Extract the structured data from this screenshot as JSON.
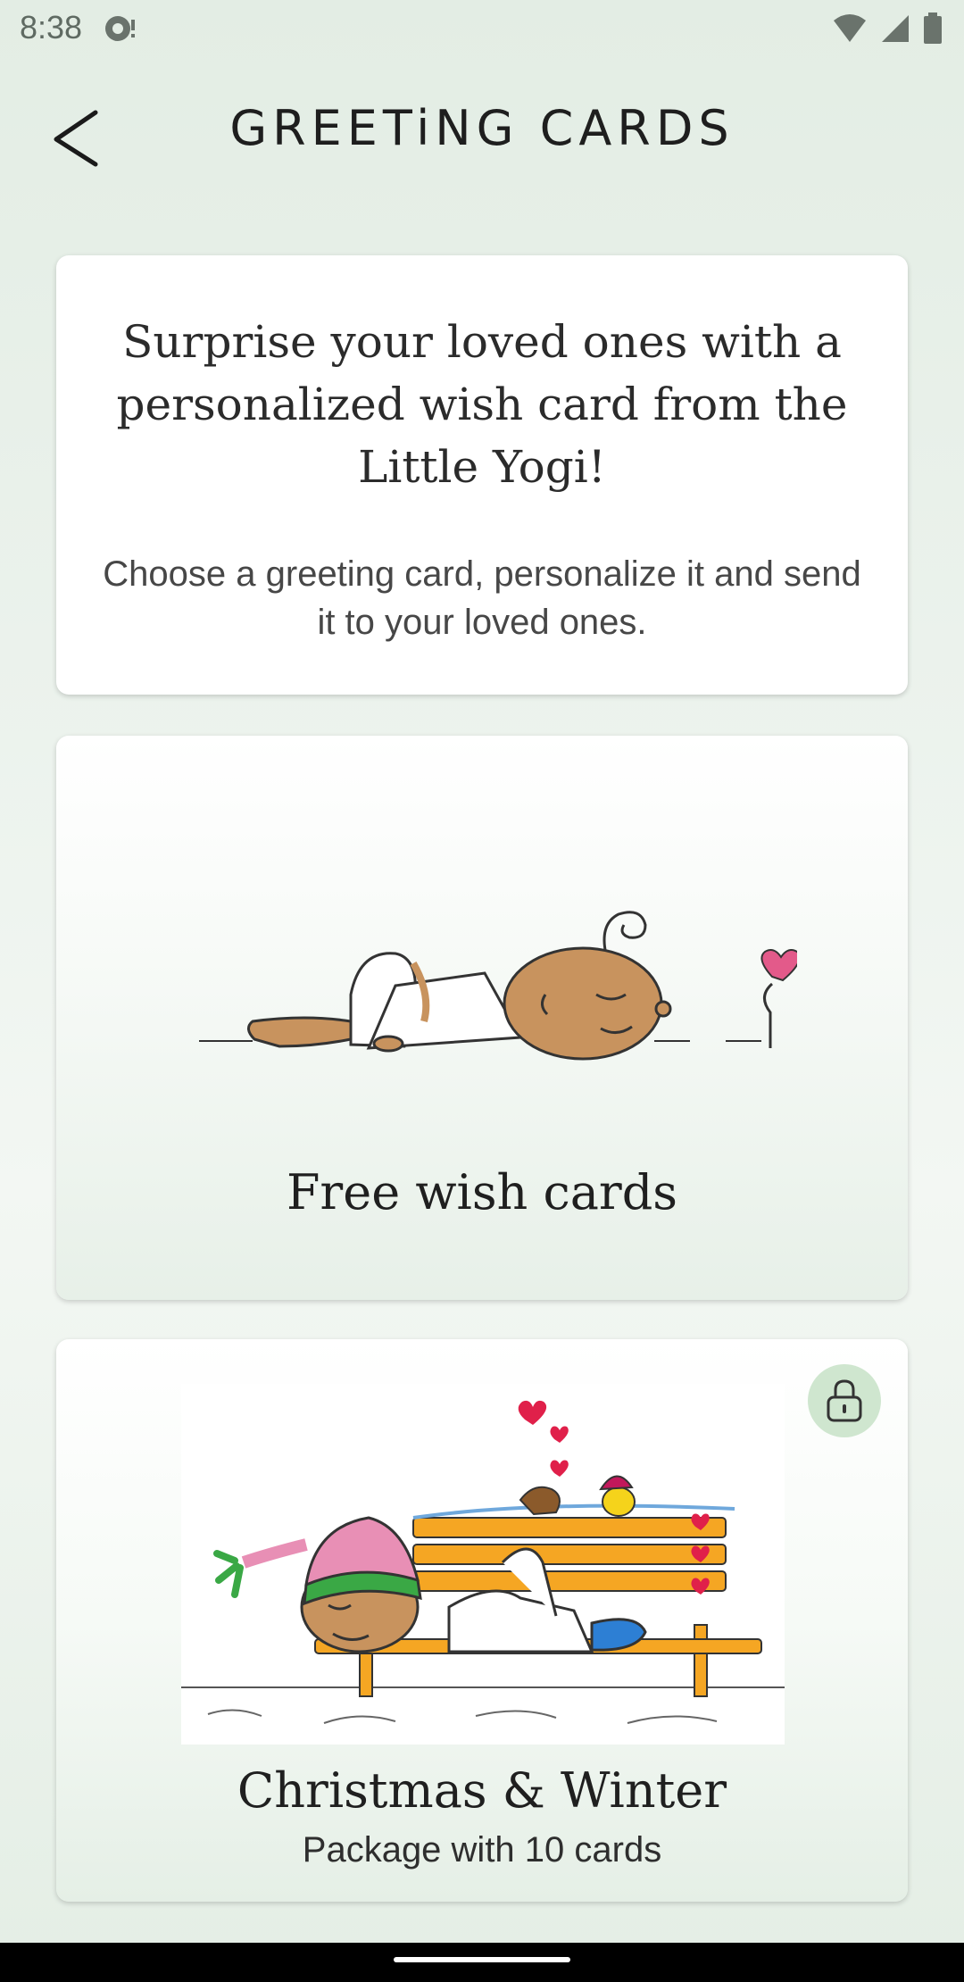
{
  "status_bar": {
    "time": "8:38",
    "icons": [
      "notification-icon",
      "wifi-icon",
      "signal-icon",
      "battery-icon"
    ]
  },
  "app_bar": {
    "back_icon": "back-arrow-icon",
    "title": "GREETiNG CARDS"
  },
  "intro": {
    "heading": "Surprise your loved ones with a personalized wish card from the Little Yogi!",
    "subtext": "Choose a greeting card, personalize it and send it to your loved ones."
  },
  "cards": [
    {
      "title": "Free wish cards",
      "illustration": "little-yogi-lying-with-heart-flower"
    },
    {
      "title": "Christmas & Winter",
      "subtitle": "Package with 10 cards",
      "illustration": "little-yogi-on-winter-bench",
      "locked": true,
      "lock_icon": "lock-icon"
    }
  ],
  "colors": {
    "background": "#e3ede4",
    "card": "#ffffff",
    "lock_badge": "#cfe6cf",
    "bench": "#f5a623",
    "heart": "#e0204a"
  }
}
